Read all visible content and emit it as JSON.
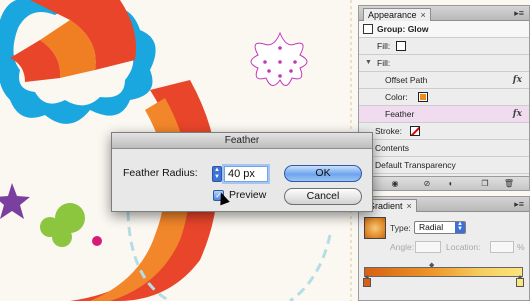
{
  "appearance": {
    "tab_label": "Appearance",
    "close_glyph": "×",
    "menu_glyph": "▸≡",
    "rows": [
      {
        "label": "Group: Glow",
        "kind": "group"
      },
      {
        "label": "Fill:",
        "kind": "fill-none"
      },
      {
        "label": "Fill:",
        "kind": "fill-expanded"
      },
      {
        "label": "Offset Path",
        "kind": "effect"
      },
      {
        "label": "Color:",
        "kind": "color",
        "swatch": "#f08a1a"
      },
      {
        "label": "Feather",
        "kind": "effect-selected"
      },
      {
        "label": "Stroke:",
        "kind": "stroke-none"
      },
      {
        "label": "Contents",
        "kind": "plain"
      },
      {
        "label": "Default Transparency",
        "kind": "plain"
      }
    ],
    "fx_glyph": "fx",
    "toolbar_icons": [
      "visibility-icon",
      "clear-icon",
      "reduce-icon",
      "duplicate-icon",
      "delete-icon"
    ]
  },
  "gradient": {
    "tab_label": "Gradient",
    "close_glyph": "×",
    "menu_glyph": "▸≡",
    "type_label": "Type:",
    "type_value": "Radial",
    "angle_label": "Angle:",
    "location_label": "Location:",
    "percent": "%",
    "stops_colors": [
      "#d95f14",
      "#fbe57d"
    ]
  },
  "dialog": {
    "title": "Feather",
    "radius_label": "Feather Radius:",
    "radius_value": "40 px",
    "ok_label": "OK",
    "cancel_label": "Cancel",
    "preview_label": "Preview",
    "preview_checked": true
  }
}
